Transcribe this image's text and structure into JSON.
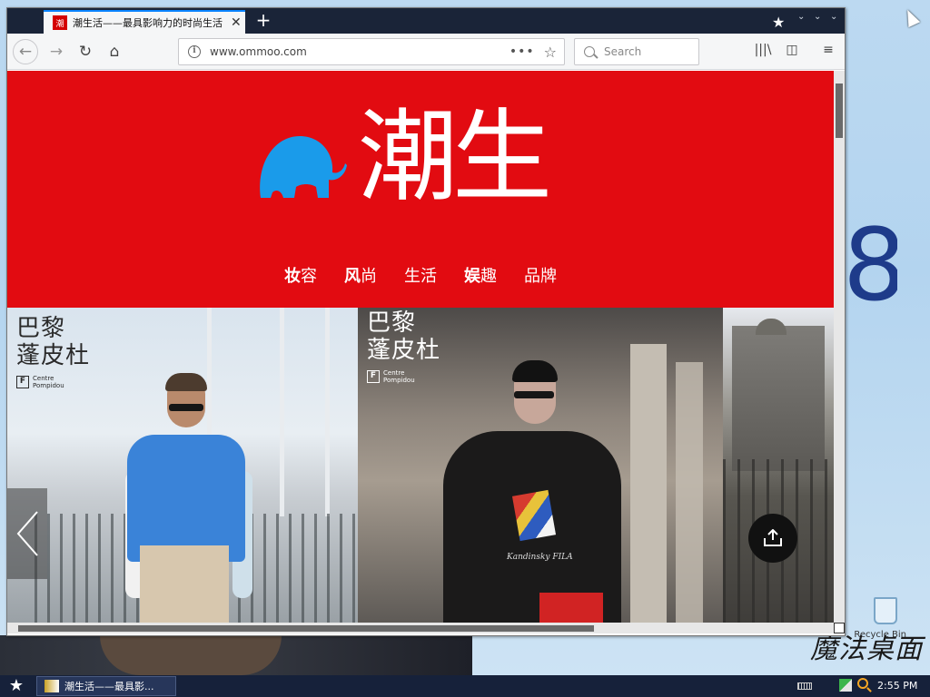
{
  "browser": {
    "tab": {
      "favicon_label": "潮",
      "title": "潮生活——最具影响力的时尚生活",
      "close_label": "✕"
    },
    "new_tab_label": "+",
    "address": {
      "url": "www.ommoo.com",
      "page_actions": "•••"
    },
    "search": {
      "placeholder": "Search"
    }
  },
  "page": {
    "logo_text": "潮生",
    "menu": [
      {
        "bold": "妆",
        "rest": "容"
      },
      {
        "bold": "风",
        "rest": "尚"
      },
      {
        "bold": "",
        "rest": "生活"
      },
      {
        "bold": "娱",
        "rest": "趣"
      },
      {
        "bold": "",
        "rest": "品牌"
      }
    ],
    "slides": [
      {
        "badge_cn": "巴黎\n蓬皮杜",
        "badge_mark": "F",
        "badge_small": "Centre\nPompidou"
      },
      {
        "badge_cn": "巴黎\n蓬皮杜",
        "badge_mark": "F",
        "badge_small": "Centre\nPompidou",
        "shirt_print": "Kandinsky FILA"
      }
    ]
  },
  "desktop": {
    "digit": "8",
    "brand": "魔法桌面",
    "recycle_label": "Recycle Bin"
  },
  "taskbar": {
    "task_label": "潮生活——最具影...",
    "clock": "2:55 PM"
  },
  "colors": {
    "hero_red": "#e20b11",
    "elephant_blue": "#1a9bea",
    "taskbar": "#16213a"
  }
}
